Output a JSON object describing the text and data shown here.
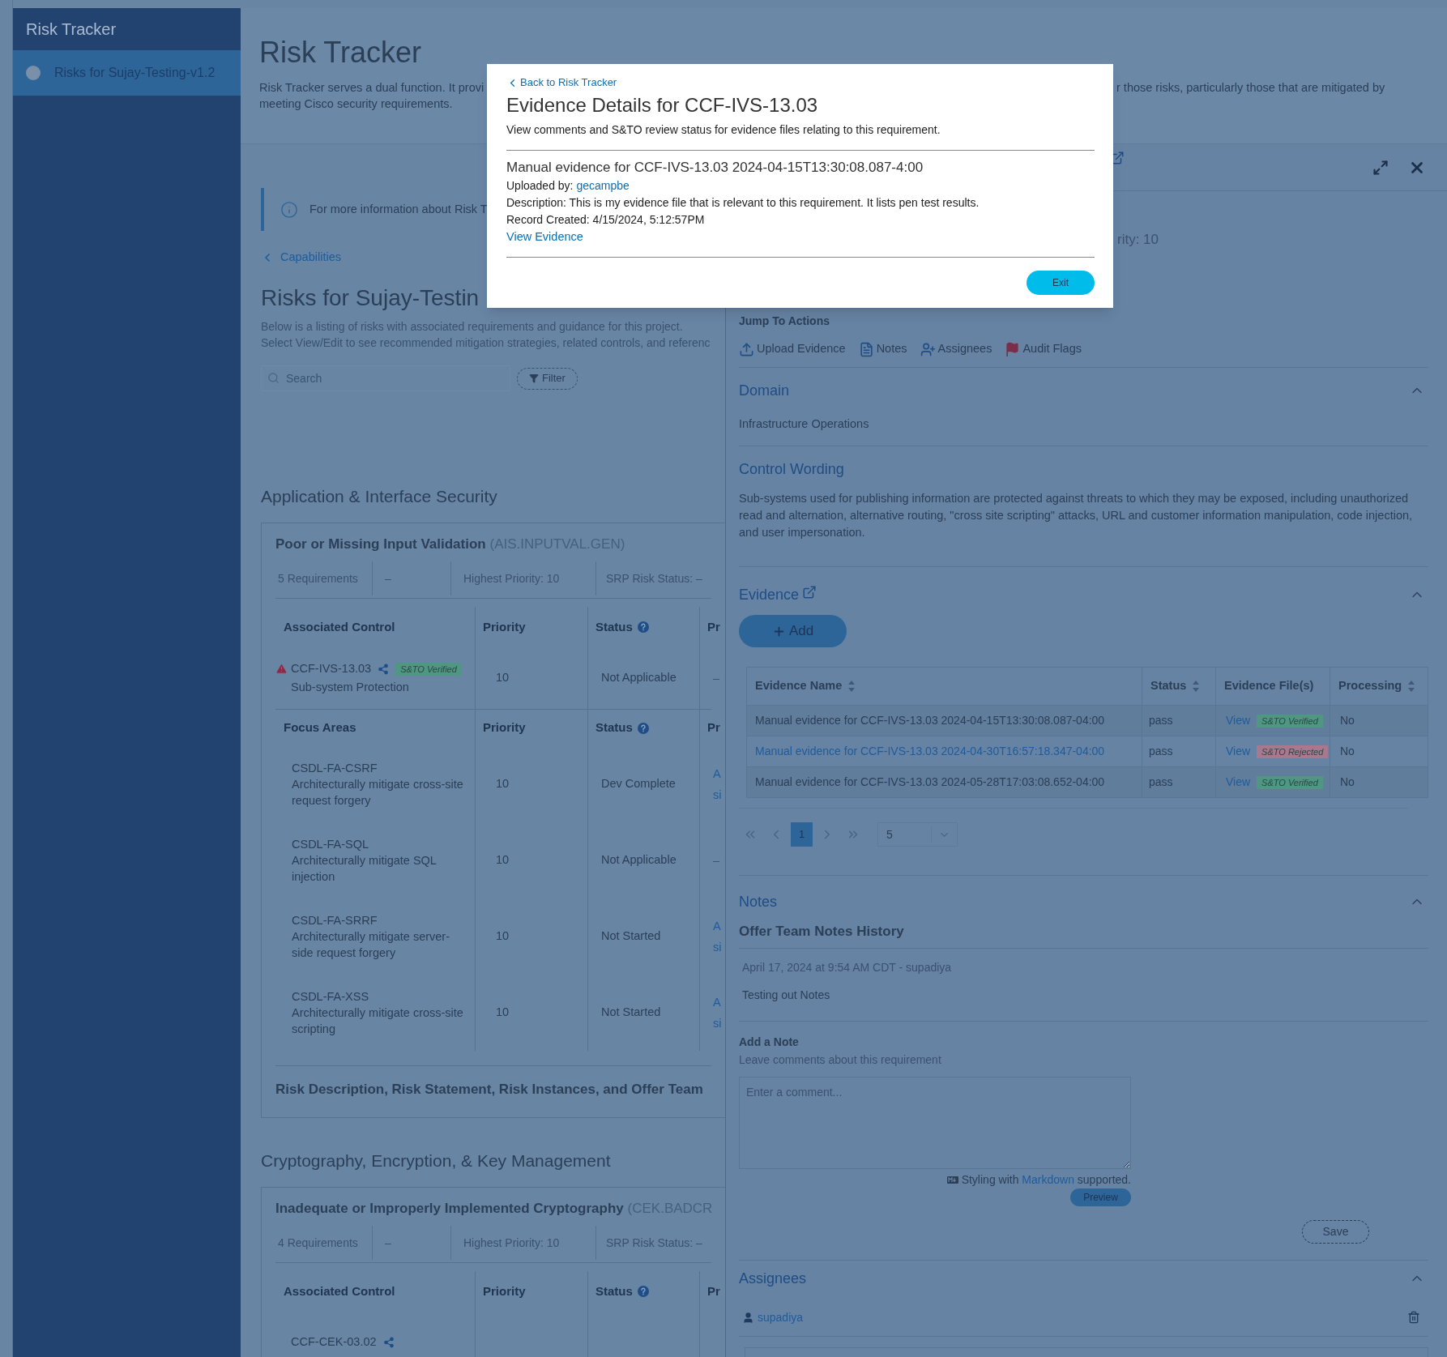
{
  "sidebar": {
    "title": "Risk Tracker",
    "items": [
      {
        "label": "Risks for Sujay-Testing-v1.2",
        "selected": true
      }
    ]
  },
  "header": {
    "title": "Risk Tracker",
    "description_left": "Risk Tracker serves a dual function. It provi",
    "description_right": "r those risks, particularly those that are mitigated by",
    "description_line2": "meeting Cisco security requirements."
  },
  "info_banner": "For more information about Risk T",
  "breadcrumb": "Capabilities",
  "project": {
    "title": "Risks for Sujay-Testin",
    "description": [
      "Below is a listing of risks with associated requirements and guidance for this project.",
      "Select View/Edit to see recommended mitigation strategies, related controls, and referenc"
    ]
  },
  "search": {
    "placeholder": "Search"
  },
  "filter_button": "Filter",
  "categories": [
    {
      "title": "Application & Interface Security",
      "risk": {
        "name": "Poor or Missing Input Validation",
        "code": "(AIS.INPUTVAL.GEN)",
        "stats": [
          "5 Requirements",
          "–",
          "Highest Priority: 10",
          "SRP Risk Status: –"
        ],
        "columns": [
          {
            "label": "Associated Control",
            "help": false
          },
          {
            "label": "Priority",
            "help": false
          },
          {
            "label": "Status",
            "help": true
          },
          {
            "label": "Pr",
            "help": false
          }
        ],
        "controls": [
          {
            "id": "CCF-IVS-13.03",
            "warning": true,
            "badge": {
              "text": "S&TO Verified",
              "color": "#4f9683"
            },
            "name": "Sub-system Protection",
            "priority": "10",
            "status": "Not Applicable",
            "column_4": [
              "–"
            ]
          }
        ],
        "focus_columns": [
          {
            "label": "Focus Areas",
            "help": false
          },
          {
            "label": "Priority",
            "help": false
          },
          {
            "label": "Status",
            "help": true
          },
          {
            "label": "Pr",
            "help": false
          }
        ],
        "focus_areas": [
          {
            "code": "CSDL-FA-CSRF",
            "description": "Architecturally mitigate cross-site request forgery",
            "priority": "10",
            "status": "Dev Complete",
            "column_4": [
              "A",
              "si"
            ]
          },
          {
            "code": "CSDL-FA-SQL",
            "description": "Architecturally mitigate SQL injection",
            "priority": "10",
            "status": "Not Applicable",
            "column_4": [
              "–"
            ]
          },
          {
            "code": "CSDL-FA-SRRF",
            "description": "Architecturally mitigate server-side request forgery",
            "priority": "10",
            "status": "Not Started",
            "column_4": [
              "A",
              "si"
            ]
          },
          {
            "code": "CSDL-FA-XSS",
            "description": "Architecturally mitigate cross-site scripting",
            "priority": "10",
            "status": "Not Started",
            "column_4": [
              "A",
              "si"
            ]
          }
        ],
        "footer": "Risk Description, Risk Statement, Risk Instances, and Offer Team"
      }
    },
    {
      "title": "Cryptography, Encryption, & Key Management",
      "risk": {
        "name": "Inadequate or Improperly Implemented Cryptography",
        "code": "(CEK.BADCR",
        "stats": [
          "4 Requirements",
          "–",
          "Highest Priority: 10",
          "SRP Risk Status: –"
        ],
        "columns": [
          {
            "label": "Associated Control",
            "help": false
          },
          {
            "label": "Priority",
            "help": false
          },
          {
            "label": "Status",
            "help": true
          },
          {
            "label": "Pr",
            "help": false
          }
        ],
        "controls": [
          {
            "id": "CCF-CEK-03.02",
            "warning": false
          }
        ]
      }
    }
  ],
  "detail_panel": {
    "partial_text": "rity: 10",
    "jump_title": "Jump To Actions",
    "actions": [
      {
        "label": "Upload Evidence",
        "kind": "upload"
      },
      {
        "label": "Notes",
        "kind": "notes"
      },
      {
        "label": "Assignees",
        "kind": "assignees"
      },
      {
        "label": "Audit Flags",
        "kind": "flag"
      }
    ],
    "domain": {
      "title": "Domain",
      "expanded": true,
      "value": "Infrastructure Operations"
    },
    "control_wording": {
      "title": "Control Wording",
      "text": "Sub-systems used for publishing information are protected against threats to which they may be exposed, including unauthorized read and alternation, alternative routing, \"cross site scripting\" attacks, URL and customer information manipulation, code injection, and user impersonation."
    },
    "evidence": {
      "title": "Evidence",
      "expanded": true,
      "add_button": "Add",
      "columns": [
        {
          "label": "Evidence Name",
          "sortable": true
        },
        {
          "label": "Status",
          "sortable": true
        },
        {
          "label": "Evidence File(s)",
          "sortable": false
        },
        {
          "label": "Processing",
          "sortable": true
        }
      ],
      "rows": [
        {
          "name": "Manual evidence for CCF-IVS-13.03 2024-04-15T13:30:08.087-04:00",
          "link": false,
          "status": "pass",
          "file_link": "View",
          "badge": {
            "text": "S&TO Verified",
            "color": "#4f9683"
          },
          "processing": "No"
        },
        {
          "name": "Manual evidence for CCF-IVS-13.03 2024-04-30T16:57:18.347-04:00",
          "link": true,
          "status": "pass",
          "file_link": "View",
          "badge": {
            "text": "S&TO Rejected",
            "color": "#a8788f"
          },
          "processing": "No"
        },
        {
          "name": "Manual evidence for CCF-IVS-13.03 2024-05-28T17:03:08.652-04:00",
          "link": false,
          "status": "pass",
          "file_link": "View",
          "badge": {
            "text": "S&TO Verified",
            "color": "#4f9683"
          },
          "processing": "No"
        }
      ],
      "pagination": {
        "pages": [
          {
            "label": "1",
            "selected": true
          }
        ],
        "page_size": "5"
      }
    },
    "notes": {
      "title": "Notes",
      "expanded": true,
      "history_title": "Offer Team Notes History",
      "entries": [
        {
          "meta": "April 17, 2024 at 9:54 AM CDT - supadiya",
          "text": "Testing out Notes"
        }
      ],
      "add_title": "Add a Note",
      "add_hint": "Leave comments about this requirement",
      "placeholder": "Enter a comment...",
      "markdown_before": "Styling with",
      "markdown_link": "Markdown",
      "markdown_after": "supported.",
      "preview_button": "Preview",
      "save_button": "Save"
    },
    "assignees": {
      "title": "Assignees",
      "expanded": true,
      "people": [
        "supadiya"
      ]
    }
  },
  "modal": {
    "back_link": "Back to Risk Tracker",
    "title": "Evidence Details for CCF-IVS-13.03",
    "subtitle": "View comments and S&TO review status for evidence files relating to this requirement.",
    "evidence_title": "Manual evidence for CCF-IVS-13.03 2024-04-15T13:30:08.087-4:00",
    "uploaded_label": "Uploaded by:",
    "uploader": "gecampbe",
    "description": "Description: This is my evidence file that is relevant to this requirement. It lists pen test results.",
    "record_created": "Record Created: 4/15/2024, 5:12:57PM",
    "view_link": "View Evidence",
    "exit_button": "Exit"
  }
}
